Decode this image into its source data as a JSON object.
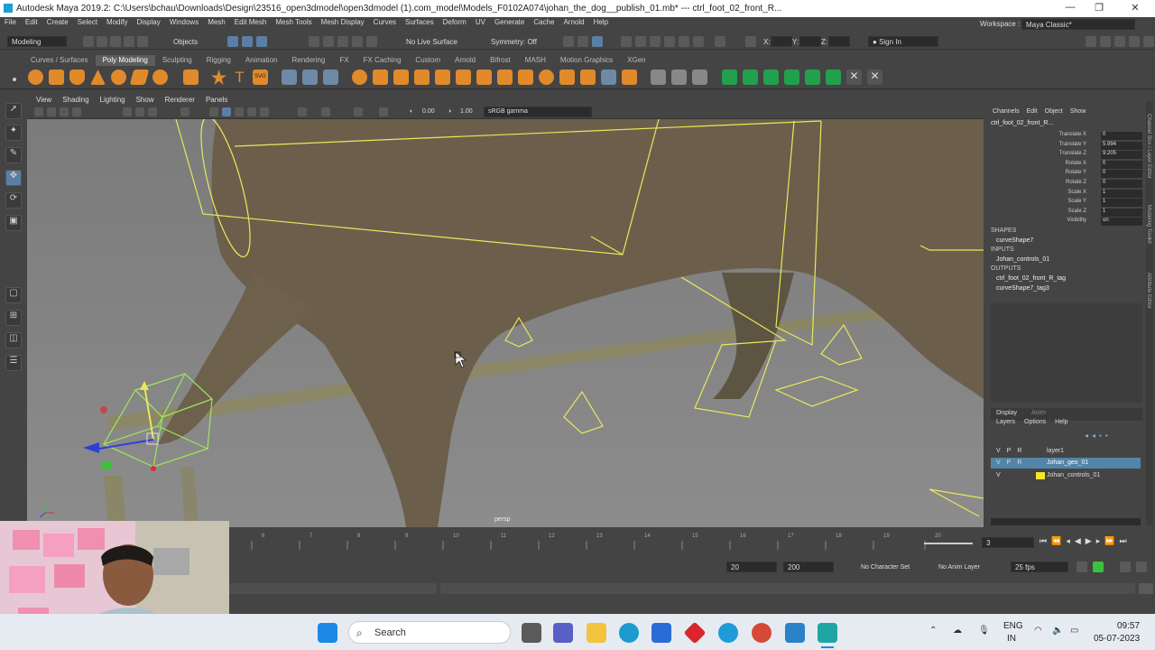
{
  "title_bar": {
    "title": "Autodesk Maya 2019.2: C:\\Users\\bchau\\Downloads\\Design\\23516_open3dmodel\\open3dmodel (1).com_model\\Models_F0102A074\\johan_the_dog__publish_01.mb*  ---  ctrl_foot_02_front_R..."
  },
  "menu": [
    "File",
    "Edit",
    "Create",
    "Select",
    "Modify",
    "Display",
    "Windows",
    "Mesh",
    "Edit Mesh",
    "Mesh Tools",
    "Mesh Display",
    "Curves",
    "Surfaces",
    "Deform",
    "UV",
    "Generate",
    "Cache",
    "Arnold",
    "Help"
  ],
  "workspace": {
    "label": "Workspace :",
    "value": "Maya Classic*"
  },
  "status_line": {
    "mode": "Modeling",
    "objects": "Objects",
    "live_surface": "No Live Surface",
    "symmetry": "Symmetry: Off",
    "sign_in": "Sign In",
    "x_label": "X:",
    "y_label": "Y:",
    "z_label": "Z:"
  },
  "shelf_tabs": [
    "Curves / Surfaces",
    "Poly Modeling",
    "Sculpting",
    "Rigging",
    "Animation",
    "Rendering",
    "FX",
    "FX Caching",
    "Custom",
    "Arnold",
    "Bifrost",
    "MASH",
    "Motion Graphics",
    "XGen"
  ],
  "viewport": {
    "menus": [
      "View",
      "Shading",
      "Lighting",
      "Show",
      "Renderer",
      "Panels"
    ],
    "exposure": "0.00",
    "gamma": "1.00",
    "color_space": "sRGB gamma",
    "camera_label": "persp"
  },
  "channel_box": {
    "tabs": [
      "Channels",
      "Edit",
      "Object",
      "Show"
    ],
    "object_name": "ctrl_foot_02_front_R...",
    "attributes": [
      {
        "name": "Translate X",
        "value": "0"
      },
      {
        "name": "Translate Y",
        "value": "5.994"
      },
      {
        "name": "Translate Z",
        "value": "9.205"
      },
      {
        "name": "Rotate X",
        "value": "0"
      },
      {
        "name": "Rotate Y",
        "value": "0"
      },
      {
        "name": "Rotate Z",
        "value": "0"
      },
      {
        "name": "Scale X",
        "value": "1"
      },
      {
        "name": "Scale Y",
        "value": "1"
      },
      {
        "name": "Scale Z",
        "value": "1"
      },
      {
        "name": "Visibility",
        "value": "on"
      }
    ],
    "shapes_header": "SHAPES",
    "shape": "curveShape7",
    "inputs_header": "INPUTS",
    "input": "Johan_controls_01",
    "outputs_header": "OUTPUTS",
    "outputs": [
      "ctrl_foot_02_front_R_tag",
      "curveShape7_tag3"
    ],
    "side_tabs": [
      "Channel Box / Layer Editor",
      "Modeling Toolkit",
      "Attribute Editor"
    ]
  },
  "layer_editor": {
    "tabs": [
      "Display",
      "Anim"
    ],
    "menus": [
      "Layers",
      "Options",
      "Help"
    ],
    "col_headers": [
      "V",
      "P",
      "R"
    ],
    "layers": [
      {
        "v": "V",
        "p": "P",
        "r": "R",
        "name": "layer1",
        "color": "#444444",
        "selected": false
      },
      {
        "v": "V",
        "p": "P",
        "r": "R",
        "name": "Johan_geo_01",
        "color": "#3a3a3a",
        "selected": true
      },
      {
        "v": "V",
        "p": "",
        "r": "",
        "name": "Johan_controls_01",
        "color": "#f5e62a",
        "selected": false
      }
    ]
  },
  "timeline": {
    "ticks": [
      "",
      "",
      "",
      "",
      "",
      "",
      "",
      "",
      "",
      "",
      "",
      "",
      "",
      "",
      "",
      "",
      ""
    ],
    "labels": [
      "6",
      "7",
      "8",
      "9",
      "10",
      "11",
      "12",
      "13",
      "14",
      "15",
      "16",
      "17",
      "18",
      "19",
      "20"
    ],
    "current_frame": "3"
  },
  "range": {
    "start": "20",
    "end": "200",
    "character_set": "No Character Set",
    "anim_layer": "No Anim Layer",
    "fps": "25 fps"
  },
  "taskbar": {
    "search_placeholder": "Search",
    "lang_top": "ENG",
    "lang_bottom": "IN",
    "time": "09:57",
    "date": "05-07-2023"
  }
}
